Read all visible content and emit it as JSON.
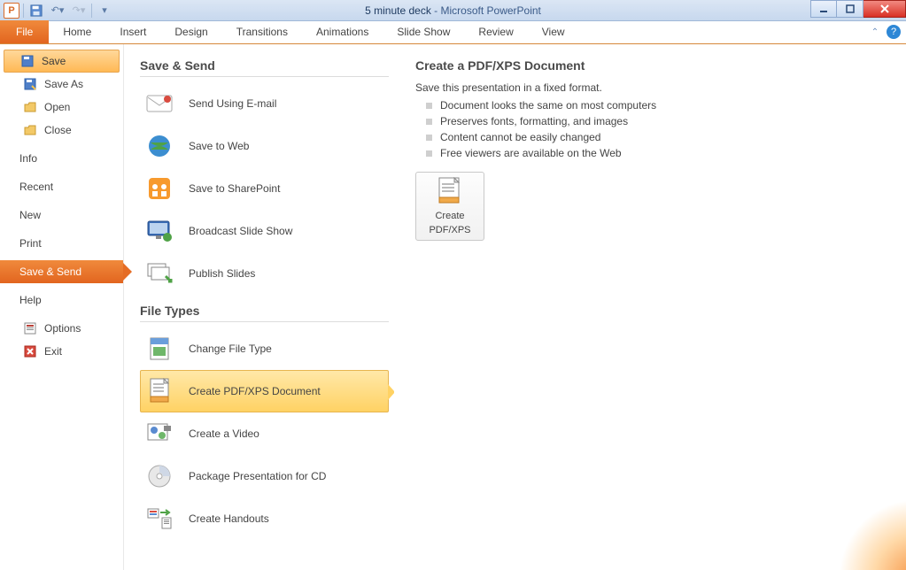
{
  "window": {
    "doc_name": "5 minute deck",
    "app_name": "Microsoft PowerPoint"
  },
  "ribbon_tabs": {
    "file": "File",
    "home": "Home",
    "insert": "Insert",
    "design": "Design",
    "transitions": "Transitions",
    "animations": "Animations",
    "slideshow": "Slide Show",
    "review": "Review",
    "view": "View"
  },
  "leftnav": {
    "save": "Save",
    "save_as": "Save As",
    "open": "Open",
    "close": "Close",
    "info": "Info",
    "recent": "Recent",
    "new": "New",
    "print": "Print",
    "save_send": "Save & Send",
    "help": "Help",
    "options": "Options",
    "exit": "Exit"
  },
  "mid": {
    "section1": "Save & Send",
    "email": "Send Using E-mail",
    "web": "Save to Web",
    "sharepoint": "Save to SharePoint",
    "broadcast": "Broadcast Slide Show",
    "publish": "Publish Slides",
    "section2": "File Types",
    "changetype": "Change File Type",
    "pdfxps": "Create PDF/XPS Document",
    "video": "Create a Video",
    "package": "Package Presentation for CD",
    "handouts": "Create Handouts"
  },
  "right": {
    "title": "Create a PDF/XPS Document",
    "sub": "Save this presentation in a fixed format.",
    "b1": "Document looks the same on most computers",
    "b2": "Preserves fonts, formatting, and images",
    "b3": "Content cannot be easily changed",
    "b4": "Free viewers are available on the Web",
    "btn_l1": "Create",
    "btn_l2": "PDF/XPS"
  }
}
